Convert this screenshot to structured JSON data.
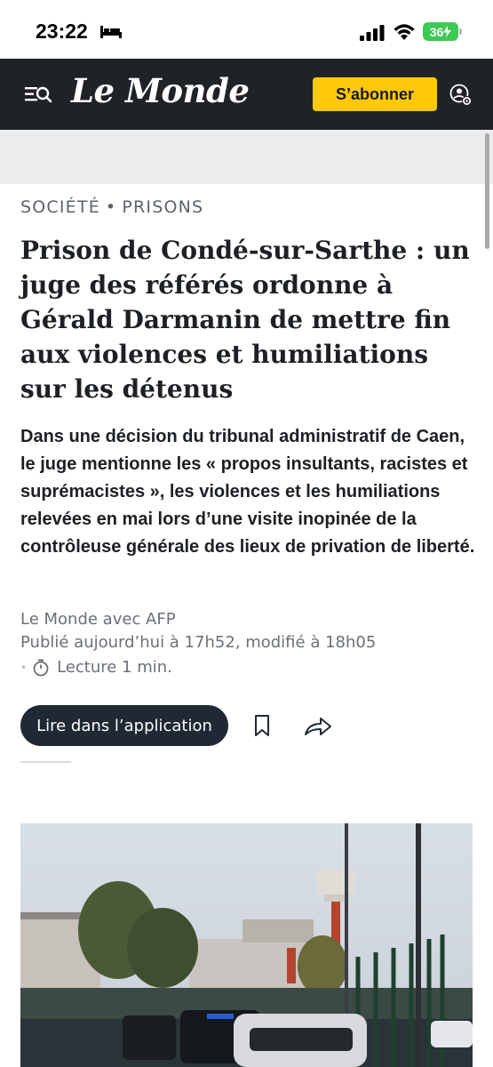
{
  "status_bar": {
    "time": "23:22",
    "battery": "36"
  },
  "header": {
    "logo": "Le Monde",
    "subscribe_label": "S’abonner"
  },
  "article": {
    "kicker_section": "SOCIÉTÉ",
    "kicker_separator": "•",
    "kicker_subsection": "PRISONS",
    "headline": "Prison de Condé-sur-Sarthe : un juge des référés ordonne à Gérald Darmanin de mettre fin aux violences et humiliations sur les détenus",
    "standfirst": "Dans une décision du tribunal administratif de Caen, le juge mentionne les « propos insultants, racistes et suprémacistes », les violences et les humiliations relevées en mai lors d’une visite inopinée de la contrôleuse générale des lieux de privation de liberté.",
    "byline": "Le Monde avec AFP",
    "dates": "Publié aujourd’hui à 17h52, modifié à 18h05",
    "reading_bullet": "•",
    "reading_time": "Lecture 1 min."
  },
  "actions": {
    "read_in_app_label": "Lire dans l’application"
  },
  "colors": {
    "header_bg": "#1f2227",
    "subscribe_bg": "#ffc80a",
    "app_button_bg": "#1f2833",
    "battery_green": "#3ec954"
  }
}
